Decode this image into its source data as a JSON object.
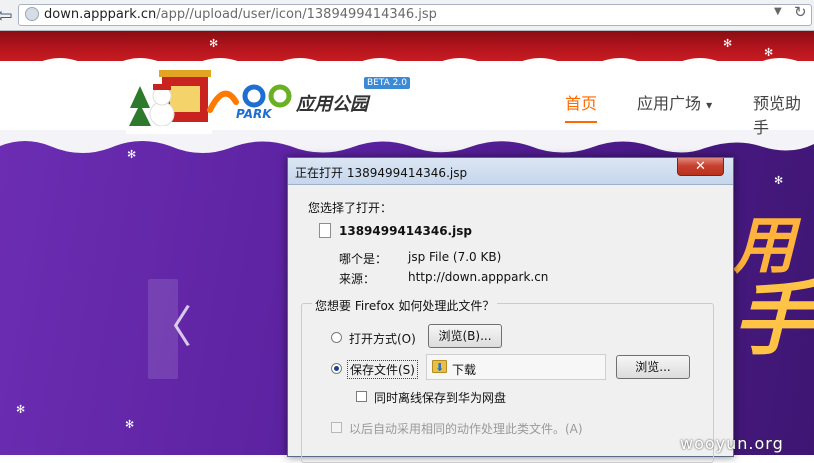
{
  "browser": {
    "url_host": "down.apppark.cn",
    "url_path": "/app//upload/user/icon/1389499414346.jsp"
  },
  "site": {
    "brand": "应用公园",
    "beta_badge": "BETA 2.0",
    "nav": [
      "首页",
      "应用广场",
      "预览助手"
    ],
    "nav_dropdown_glyph": "▾",
    "banner_text": [
      "用",
      "手"
    ],
    "prev_arrow": "〈",
    "watermark": "wooyun.org"
  },
  "dialog": {
    "title": "正在打开 1389499414346.jsp",
    "close_glyph": "✕",
    "chosen_label": "您选择了打开：",
    "file_name": "1389499414346.jsp",
    "type_label": "哪个是：",
    "type_value": "jsp File (7.0 KB)",
    "source_label": "来源：",
    "source_value": "http://down.apppark.cn",
    "question": "您想要 Firefox 如何处理此文件？",
    "open_with_label": "打开方式(O)",
    "browse_btn_1": "浏览(B)...",
    "save_file_label": "保存文件(S)",
    "save_location": "下载",
    "browse_btn_2": "浏览...",
    "offline_save_label": "同时离线保存到华为网盘",
    "auto_label": "以后自动采用相同的动作处理此类文件。(A)",
    "selected_option": "save_file"
  },
  "colors": {
    "nav_active": "#ff6a00",
    "header_red": "#b6151d",
    "banner_purple": "#5b22a0"
  }
}
